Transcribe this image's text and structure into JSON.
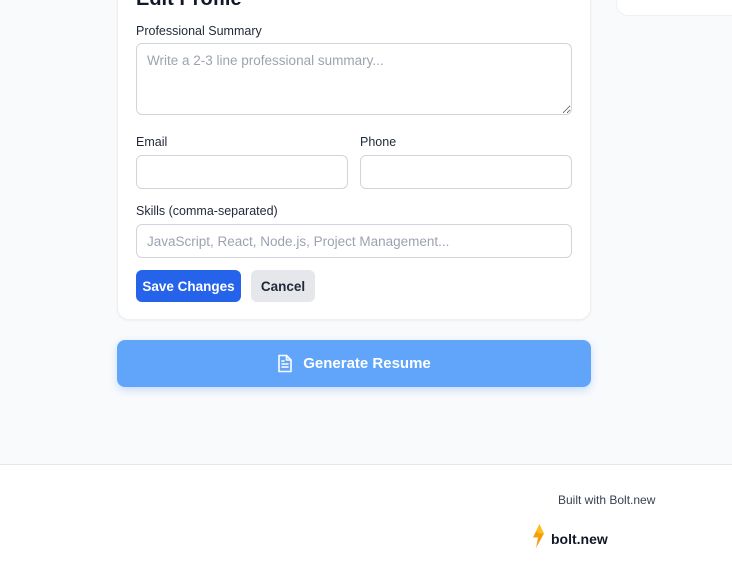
{
  "form": {
    "heading": "Edit Profile",
    "summary": {
      "label": "Professional Summary",
      "placeholder": "Write a 2-3 line professional summary...",
      "value": ""
    },
    "email": {
      "label": "Email",
      "placeholder": "",
      "value": ""
    },
    "phone": {
      "label": "Phone",
      "placeholder": "",
      "value": ""
    },
    "skills": {
      "label": "Skills (comma-separated)",
      "placeholder": "JavaScript, React, Node.js, Project Management...",
      "value": ""
    },
    "save_label": "Save Changes",
    "cancel_label": "Cancel"
  },
  "generate": {
    "label": "Generate Resume",
    "icon": "document-icon"
  },
  "footer": {
    "credit": "Built with Bolt.new",
    "badge_label": "bolt.new",
    "badge_icon": "lightning-bolt-icon"
  },
  "colors": {
    "primary": "#2563eb",
    "generate": "#60a5fa",
    "bolt": "#f59e0b"
  }
}
